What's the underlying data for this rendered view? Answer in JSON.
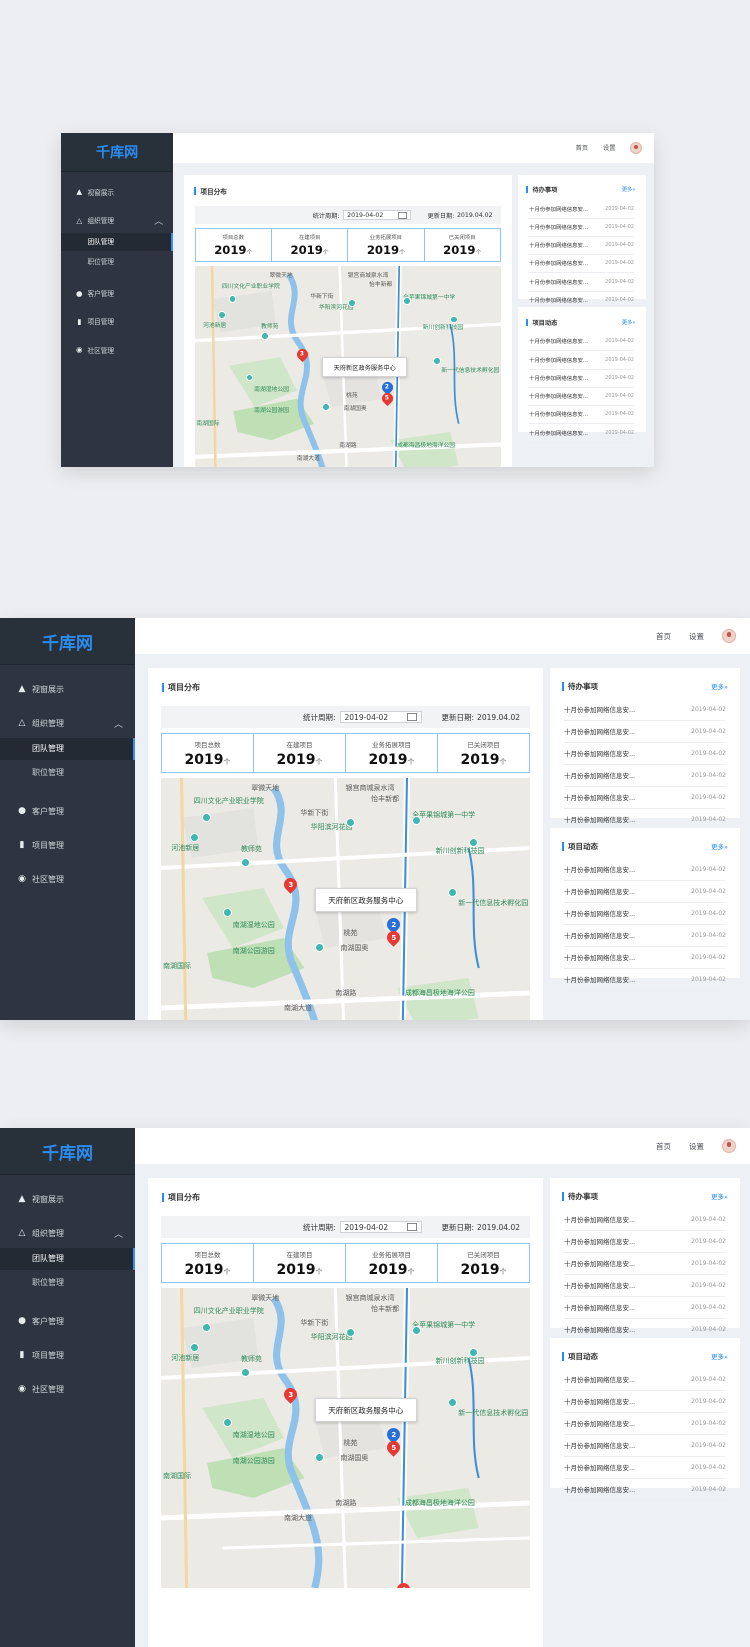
{
  "app": {
    "logo": "千库网",
    "nav": [
      {
        "label": "视窗展示",
        "icon": "chart-icon"
      },
      {
        "label": "组织管理",
        "icon": "org-icon",
        "expanded": true,
        "children": [
          {
            "label": "团队管理",
            "active": true
          },
          {
            "label": "职位管理",
            "active": false
          }
        ]
      },
      {
        "label": "客户管理",
        "icon": "user-icon"
      },
      {
        "label": "项目管理",
        "icon": "book-icon"
      },
      {
        "label": "社区管理",
        "icon": "chat-icon"
      }
    ],
    "topbar": {
      "home": "首页",
      "settings": "设置"
    }
  },
  "project": {
    "title": "项目分布",
    "period_label": "统计周期:",
    "period_value": "2019-04-02",
    "updated_label": "更新日期:",
    "updated_value": "2019.04.02",
    "stats": [
      {
        "label": "项目总数",
        "value": "2019",
        "unit": "个"
      },
      {
        "label": "在建项目",
        "value": "2019",
        "unit": "个"
      },
      {
        "label": "业务拓展项目",
        "value": "2019",
        "unit": "个"
      },
      {
        "label": "已关闭项目",
        "value": "2019",
        "unit": "个"
      }
    ]
  },
  "map": {
    "callout": "天府新区政务服务中心",
    "labels": [
      "翠微天地",
      "四川文化产业职业学院",
      "河池新居",
      "教师苑",
      "银宫商城泉水湾",
      "怡丰新都",
      "华阳滨河花园",
      "全苹果锦城第一中学",
      "新川创新科技园",
      "新一代信息技术孵化园",
      "南湖湿地公园",
      "南湖公园游园",
      "南湖国际",
      "南湖路",
      "南湖大道",
      "南湖国奥",
      "桃苑",
      "华新下街",
      "成都海昌极地海洋公园",
      "阳南湖国际"
    ],
    "pins": [
      {
        "n": "3",
        "color": "red"
      },
      {
        "n": "2",
        "color": "blue"
      },
      {
        "n": "5",
        "color": "red"
      },
      {
        "n": "4",
        "color": "red"
      }
    ]
  },
  "todo": {
    "title": "待办事项",
    "more": "更多»",
    "items": [
      {
        "text": "十月份参加网络信息安...",
        "date": "2019-04-02"
      },
      {
        "text": "十月份参加网络信息安...",
        "date": "2019-04-02"
      },
      {
        "text": "十月份参加网络信息安...",
        "date": "2019-04-02"
      },
      {
        "text": "十月份参加网络信息安...",
        "date": "2019-04-02"
      },
      {
        "text": "十月份参加网络信息安...",
        "date": "2019-04-02"
      },
      {
        "text": "十月份参加网络信息安...",
        "date": "2019-04-02"
      }
    ]
  },
  "news": {
    "title": "项目动态",
    "more": "更多»",
    "items": [
      {
        "text": "十月份参加网络信息安...",
        "date": "2019-04-02"
      },
      {
        "text": "十月份参加网络信息安...",
        "date": "2019-04-02"
      },
      {
        "text": "十月份参加网络信息安...",
        "date": "2019-04-02"
      },
      {
        "text": "十月份参加网络信息安...",
        "date": "2019-04-02"
      },
      {
        "text": "十月份参加网络信息安...",
        "date": "2019-04-02"
      },
      {
        "text": "十月份参加网络信息安...",
        "date": "2019-04-02"
      }
    ]
  },
  "colors": {
    "accent": "#2b8cf0",
    "sidebar": "#2f3540",
    "content_bg": "#edf0f4"
  }
}
